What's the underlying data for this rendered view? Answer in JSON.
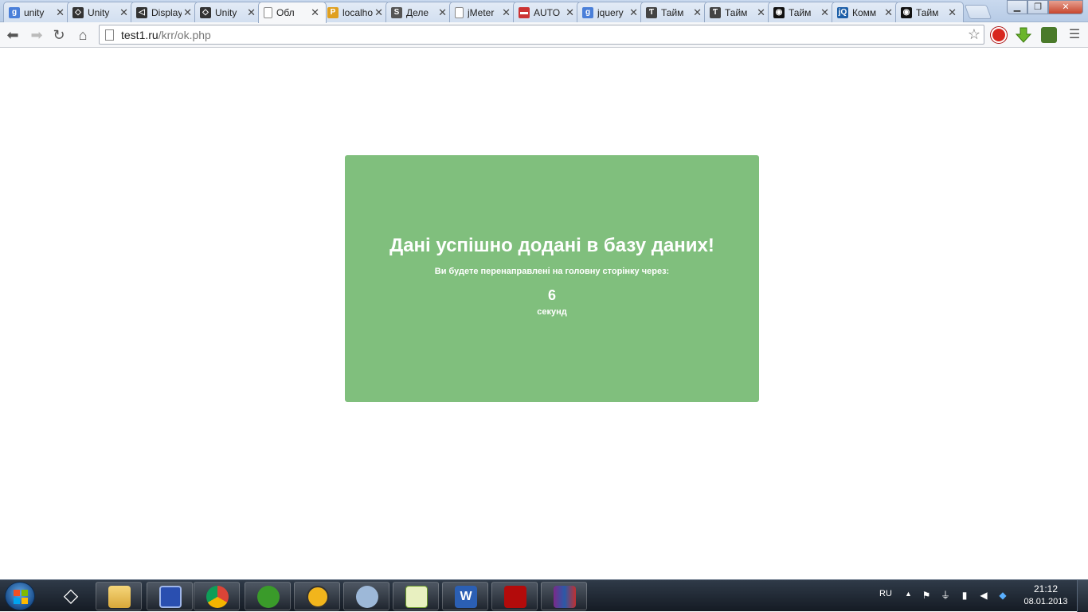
{
  "browser": {
    "tabs": [
      {
        "title": "unity",
        "icon": "google-icon",
        "color": "#4a7fd9",
        "glyph": "g"
      },
      {
        "title": "Unity",
        "icon": "unity-icon",
        "color": "#333333",
        "glyph": "◇"
      },
      {
        "title": "Display",
        "icon": "unity-icon",
        "color": "#333333",
        "glyph": "◁"
      },
      {
        "title": "Unity",
        "icon": "unity-icon",
        "color": "#333333",
        "glyph": "◇"
      },
      {
        "title": "Обл",
        "icon": "page-icon",
        "color": "#ffffff",
        "glyph": ""
      },
      {
        "title": "localhost",
        "icon": "phpmyadmin-icon",
        "color": "#e0a020",
        "glyph": "P"
      },
      {
        "title": "Деле",
        "icon": "s-icon",
        "color": "#555555",
        "glyph": "S"
      },
      {
        "title": "jMeter",
        "icon": "page-icon",
        "color": "#ffffff",
        "glyph": ""
      },
      {
        "title": "AUTO",
        "icon": "car-icon",
        "color": "#cc3333",
        "glyph": "▬"
      },
      {
        "title": "jquery",
        "icon": "google-icon",
        "color": "#4a7fd9",
        "glyph": "g"
      },
      {
        "title": "Тайм",
        "icon": "site-icon",
        "color": "#444444",
        "glyph": "Ƭ"
      },
      {
        "title": "Тайм",
        "icon": "site-icon",
        "color": "#444444",
        "glyph": "Ƭ"
      },
      {
        "title": "Тайм",
        "icon": "mask-icon",
        "color": "#111111",
        "glyph": "◉"
      },
      {
        "title": "Комм",
        "icon": "jquery-icon",
        "color": "#1d5fa8",
        "glyph": "jQ"
      },
      {
        "title": "Тайм",
        "icon": "mask-icon",
        "color": "#111111",
        "glyph": "◉"
      }
    ],
    "active_tab": 4,
    "url_host": "test1.ru",
    "url_path": "/krr/ok.php"
  },
  "page": {
    "title": "Дані успішно додані в базу даних!",
    "subtitle": "Ви будете перенаправлені на головну сторінку через:",
    "countdown": "6",
    "unit": "секунд",
    "box_color": "#80bf7d"
  },
  "taskbar": {
    "apps": [
      "unity-app",
      "file-explorer",
      "save-app",
      "chrome",
      "utorrent",
      "globe-app",
      "tuneup",
      "notepad-plus-plus",
      "word",
      "acrobat",
      "winrar"
    ],
    "language": "RU",
    "time": "21:12",
    "date": "08.01.2013"
  }
}
